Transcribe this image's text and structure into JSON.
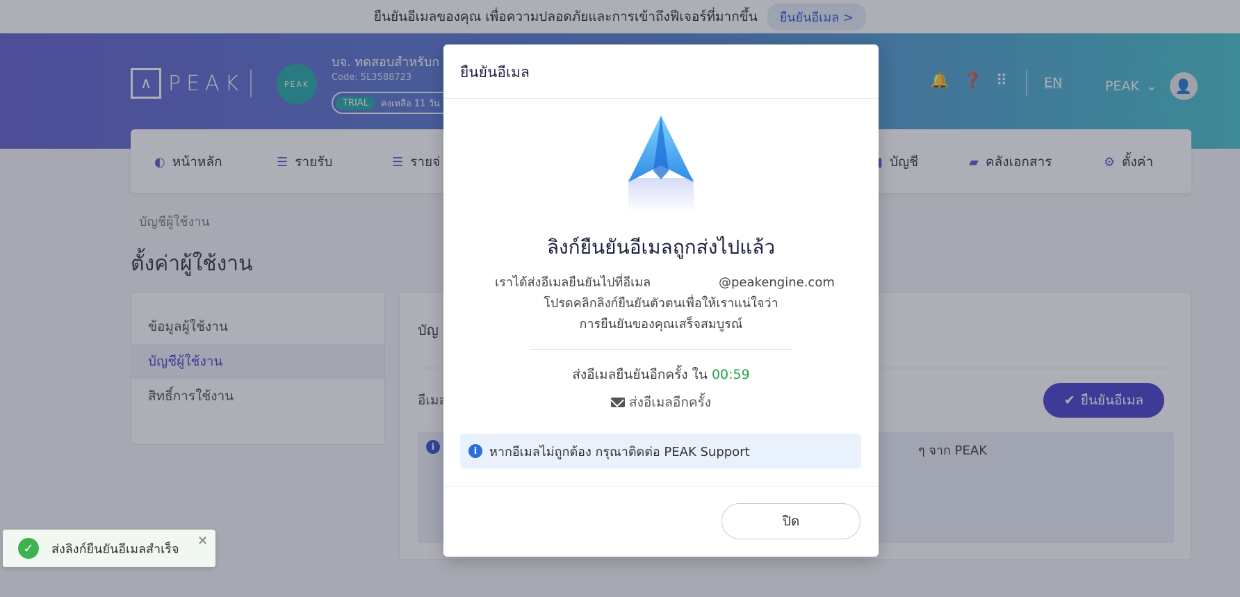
{
  "banner": {
    "text": "ยืนยันอีเมลของคุณ เพื่อความปลอดภัยและการเข้าถึงฟีเจอร์ที่มากขึ้น",
    "link": "ยืนยันอีเมล >"
  },
  "header": {
    "logo_text": "PEAK",
    "company_avatar": "PEAK",
    "company_name": "บจ. ทดสอบสำหรับก",
    "company_code": "Code: 5L3588723",
    "trial_tag": "TRIAL",
    "trial_remaining": "คงเหลือ 11 วัน",
    "lang": "EN",
    "user_name": "PEAK"
  },
  "nav": {
    "items": [
      {
        "label": "หน้าหลัก",
        "icon": "dashboard-icon"
      },
      {
        "label": "รายรับ",
        "icon": "income-icon"
      },
      {
        "label": "รายจ่",
        "icon": "expense-icon"
      },
      {
        "label": "บัญชี",
        "icon": "book-icon"
      },
      {
        "label": "คลังเอกสาร",
        "icon": "folder-icon"
      },
      {
        "label": "ตั้งค่า",
        "icon": "gear-icon"
      }
    ]
  },
  "page": {
    "breadcrumb": "บัญชีผู้ใช้งาน",
    "title": "ตั้งค่าผู้ใช้งาน"
  },
  "sidebar": {
    "items": [
      {
        "label": "ข้อมูลผู้ใช้งาน"
      },
      {
        "label": "บัญชีผู้ใช้งาน"
      },
      {
        "label": "สิทธิ์การใช้งาน"
      }
    ]
  },
  "main": {
    "title": "บัญ",
    "email_label": "อีเมล",
    "verify_button": "ยืนยันอีเมล",
    "info_text": "ๆ จาก PEAK"
  },
  "modal": {
    "title": "ยืนยันอีเมล",
    "heading": "ลิงก์ยืนยันอีเมลถูกส่งไปแล้ว",
    "message_line1": "เราได้ส่งอีเมลยืนยันไปที่อีเมล",
    "email_domain": "@peakengine.com",
    "message_line2": "โปรดคลิกลิงก์ยืนยันตัวตนเพื่อให้เราแน่ใจว่า",
    "message_line3": "การยืนยันของคุณเสร็จสมบูรณ์",
    "resend_prefix": "ส่งอีเมลยืนยันอีกครั้ง ใน",
    "countdown": "00:59",
    "resend_link": "ส่งอีเมลอีกครั้ง",
    "info_text": "หากอีเมลไม่ถูกต้อง กรุณาติดต่อ PEAK Support",
    "close_button": "ปิด"
  },
  "toast": {
    "message": "ส่งลิงก์ยืนยันอีเมลสำเร็จ"
  },
  "colors": {
    "primary": "#3e3acb",
    "success": "#21a34a",
    "header_start": "#5c59cc",
    "header_end": "#3fc1c9"
  }
}
